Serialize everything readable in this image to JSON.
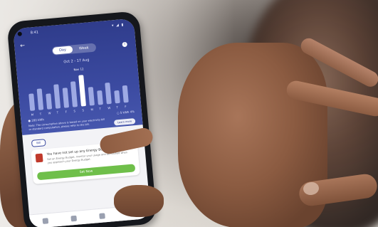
{
  "scene": {
    "description_icons": [
      "camera-punch-hole-icon",
      "back-arrow-icon",
      "info-icon",
      "lightbulb-icon"
    ]
  },
  "phone_screen": {
    "status": {
      "time": "8:41",
      "icons": "▾ ◢ ▮"
    },
    "segments": [
      "Day",
      "Week"
    ],
    "range_text": "Oct 2 - 17 Aug",
    "chart": {
      "highlight_label": "Nov 12",
      "axis_labels": [
        "M",
        "T",
        "W",
        "T",
        "F",
        "S",
        "S",
        "M",
        "T",
        "W",
        "T",
        "F"
      ]
    },
    "legend_left": "● 280 kWh",
    "legend_right": "○ 5 kWh 4%",
    "note": "Note: The consumption above is based on your electricity bill or standard computation, please refer to the bill.",
    "learn_more": "Learn more",
    "chip": "Bill",
    "card": {
      "title": "You have not set up any Energy Budget",
      "text": "Set an Energy Budget, monitor your usage and be notified when you approach your Energy Budget.",
      "button": "Set Now"
    }
  }
}
